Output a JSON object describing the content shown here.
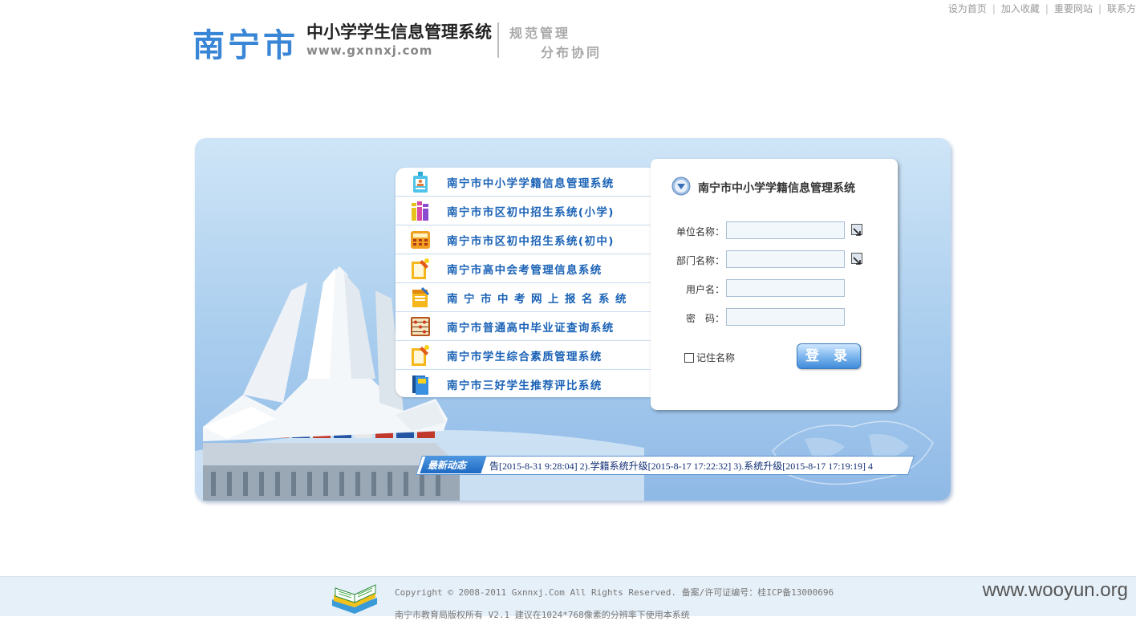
{
  "top_links": [
    "设为首页",
    "加入收藏",
    "重要网站",
    "联系方"
  ],
  "header": {
    "city": "南宁市",
    "system_name": "中小学学生信息管理系统",
    "url": "www.gxnnxj.com",
    "slogan_1": "规范管理",
    "slogan_2": "分布协同"
  },
  "menu": {
    "items": [
      {
        "label": "南宁市中小学学籍信息管理系统",
        "icon": "id-badge-icon"
      },
      {
        "label": "南宁市市区初中招生系统(小学)",
        "icon": "books-icon"
      },
      {
        "label": "南宁市市区初中招生系统(初中)",
        "icon": "calculator-icon"
      },
      {
        "label": "南宁市高中会考管理信息系统",
        "icon": "notepad-pencil-icon"
      },
      {
        "label": "南 宁 市 中 考 网 上 报 名 系 统",
        "icon": "notepad-icon"
      },
      {
        "label": "南宁市普通高中毕业证查询系统",
        "icon": "abacus-icon"
      },
      {
        "label": "南宁市学生综合素质管理系统",
        "icon": "notepad-pencil-icon"
      },
      {
        "label": "南宁市三好学生推荐评比系统",
        "icon": "book-stack-icon"
      }
    ]
  },
  "login": {
    "title": "南宁市中小学学籍信息管理系统",
    "unit_label": "单位名称：",
    "unit_value": "",
    "dept_label": "部门名称：",
    "dept_value": "",
    "user_label": "用户名：",
    "user_value": "",
    "password_label": "密　码：",
    "password_value": "",
    "remember_label": "记住名称",
    "submit_label": "登 录"
  },
  "news": {
    "tag": "最新动态",
    "text": "告[2015-8-31 9:28:04]    2).学籍系统升级[2015-8-17 17:22:32]    3).系统升级[2015-8-17 17:19:19]    4"
  },
  "footer": {
    "copyright": "Copyright © 2008-2011  Gxnnxj.Com  All Rights Reserved. 备案/许可证编号：桂ICP备13000696",
    "line2": "南宁市教育局版权所有 V2.1  建议在1024*768像素的分辨率下使用本系统"
  },
  "watermark": "www.wooyun.org",
  "colors": {
    "brand_blue": "#3a86d6",
    "menu_text": "#1a62b6",
    "panel_bg": "#a9cdee"
  }
}
